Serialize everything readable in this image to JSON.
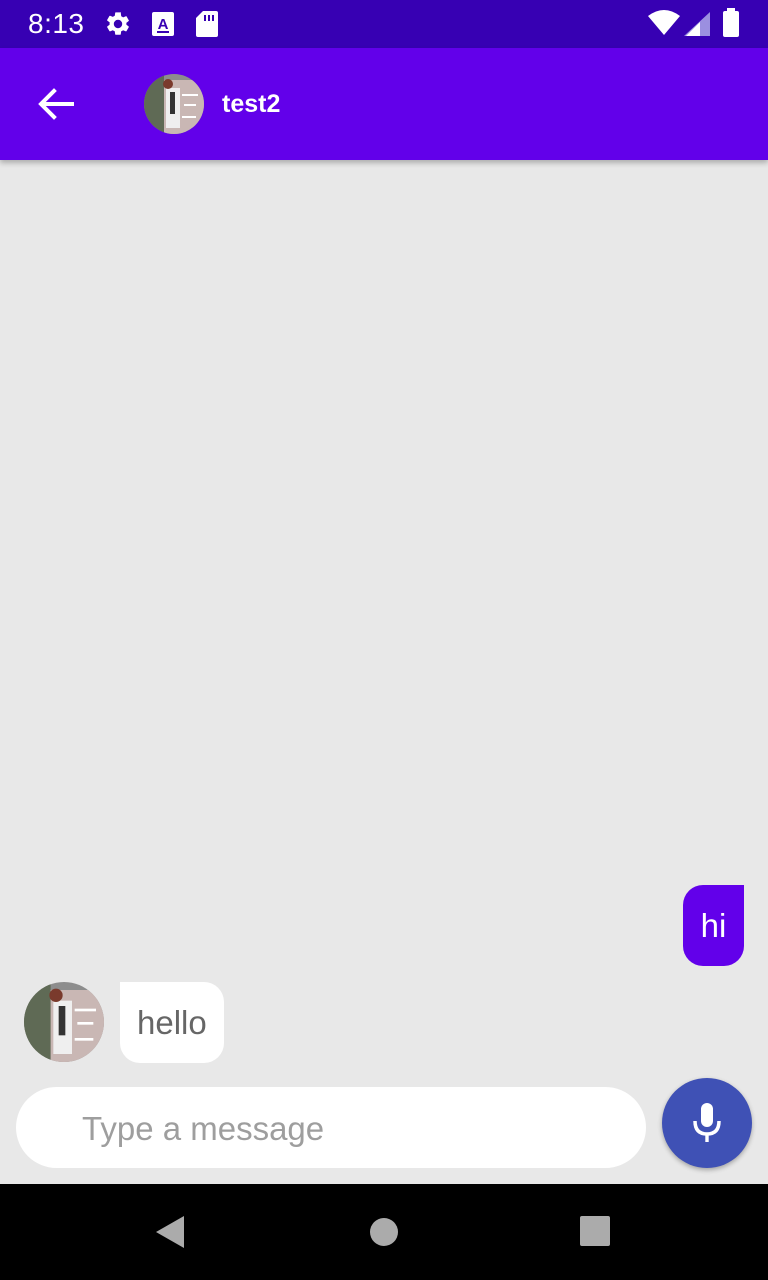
{
  "status_bar": {
    "time": "8:13",
    "left_icons": [
      "gear-icon",
      "a-keyboard-icon",
      "sd-card-icon"
    ],
    "right_icons": [
      "wifi-icon",
      "cell-signal-icon",
      "battery-icon"
    ],
    "color": "#3700b3"
  },
  "app_bar": {
    "title": "test2",
    "back_icon": "arrow-back-icon",
    "color": "#6200ea"
  },
  "messages": [
    {
      "direction": "outgoing",
      "text": "hi"
    },
    {
      "direction": "incoming",
      "text": "hello"
    }
  ],
  "composer": {
    "placeholder": "Type a message",
    "value": "",
    "mic_icon": "mic-icon",
    "mic_color": "#3f51b5"
  },
  "nav_bar": {
    "icons": [
      "nav-back-icon",
      "nav-home-icon",
      "nav-recents-icon"
    ]
  }
}
